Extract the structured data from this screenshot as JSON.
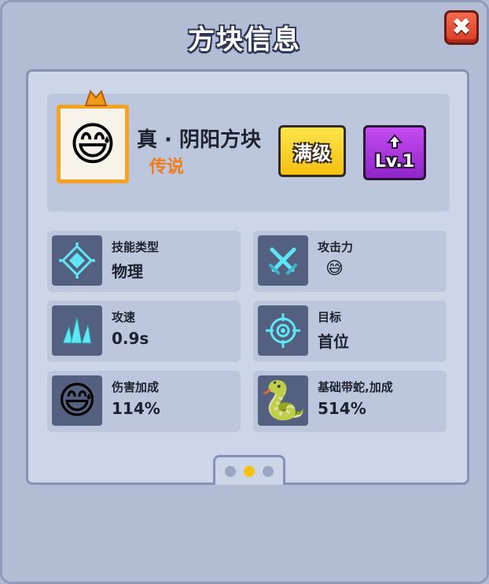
{
  "window": {
    "title": "方块信息",
    "close_label": "✖"
  },
  "block": {
    "name": "真 · 阴阳方块",
    "rarity": "传说",
    "rarity_color": "#f27c17",
    "avatar_icon": "sweat-smile-emoji",
    "avatar_glyph": "😅",
    "frame_icon": "dragon-frame"
  },
  "buttons": {
    "max_label": "满级",
    "level_label": "Lv.1",
    "level_icon": "up-arrow-icon"
  },
  "stats": [
    {
      "label": "技能类型",
      "value": "物理",
      "icon": "diamond-crosshair-icon"
    },
    {
      "label": "攻击力",
      "value": "😅",
      "icon": "crossed-swords-icon"
    },
    {
      "label": "攻速",
      "value": "0.9s",
      "icon": "ice-spikes-icon"
    },
    {
      "label": "目标",
      "value": "首位",
      "icon": "target-icon"
    },
    {
      "label": "伤害加成",
      "value": "114%",
      "icon": "sweat-smile-emoji",
      "glyph": "😅"
    },
    {
      "label": "基础带蛇,加成",
      "value": "514%",
      "icon": "snake-emoji",
      "glyph": "🐍"
    }
  ],
  "pager": {
    "total": 3,
    "active": 2
  },
  "colors": {
    "accent_yellow": "#f5c313",
    "accent_purple": "#a036d8",
    "close_red": "#d93b27"
  }
}
